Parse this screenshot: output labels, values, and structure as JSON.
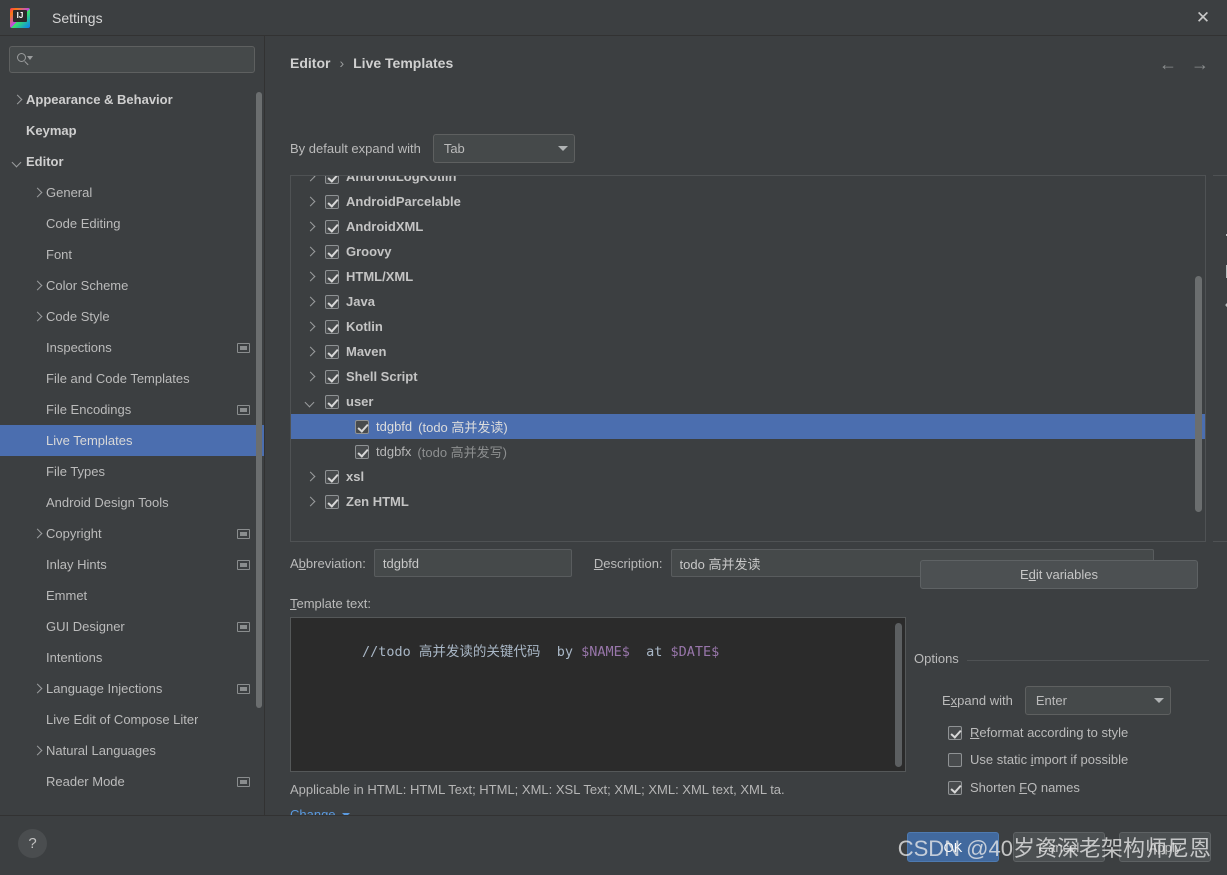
{
  "window": {
    "title": "Settings",
    "logo_icon": "intellij-idea-icon",
    "close_icon": "close-icon"
  },
  "sidebar": {
    "search": {
      "placeholder": "",
      "value": "",
      "icon": "search-icon"
    },
    "items": [
      {
        "label": "Appearance & Behavior",
        "arrow": "right",
        "indent": 0,
        "bold": true,
        "badge": false,
        "selected": false
      },
      {
        "label": "Keymap",
        "arrow": "none",
        "indent": 0,
        "bold": true,
        "badge": false,
        "selected": false
      },
      {
        "label": "Editor",
        "arrow": "down",
        "indent": 0,
        "bold": true,
        "badge": false,
        "selected": false
      },
      {
        "label": "General",
        "arrow": "right",
        "indent": 1,
        "bold": false,
        "badge": false,
        "selected": false
      },
      {
        "label": "Code Editing",
        "arrow": "none",
        "indent": 1,
        "bold": false,
        "badge": false,
        "selected": false
      },
      {
        "label": "Font",
        "arrow": "none",
        "indent": 1,
        "bold": false,
        "badge": false,
        "selected": false
      },
      {
        "label": "Color Scheme",
        "arrow": "right",
        "indent": 1,
        "bold": false,
        "badge": false,
        "selected": false
      },
      {
        "label": "Code Style",
        "arrow": "right",
        "indent": 1,
        "bold": false,
        "badge": false,
        "selected": false
      },
      {
        "label": "Inspections",
        "arrow": "none",
        "indent": 1,
        "bold": false,
        "badge": true,
        "selected": false
      },
      {
        "label": "File and Code Templates",
        "arrow": "none",
        "indent": 1,
        "bold": false,
        "badge": false,
        "selected": false
      },
      {
        "label": "File Encodings",
        "arrow": "none",
        "indent": 1,
        "bold": false,
        "badge": true,
        "selected": false
      },
      {
        "label": "Live Templates",
        "arrow": "none",
        "indent": 1,
        "bold": false,
        "badge": false,
        "selected": true
      },
      {
        "label": "File Types",
        "arrow": "none",
        "indent": 1,
        "bold": false,
        "badge": false,
        "selected": false
      },
      {
        "label": "Android Design Tools",
        "arrow": "none",
        "indent": 1,
        "bold": false,
        "badge": false,
        "selected": false
      },
      {
        "label": "Copyright",
        "arrow": "right",
        "indent": 1,
        "bold": false,
        "badge": true,
        "selected": false
      },
      {
        "label": "Inlay Hints",
        "arrow": "none",
        "indent": 1,
        "bold": false,
        "badge": true,
        "selected": false
      },
      {
        "label": "Emmet",
        "arrow": "none",
        "indent": 1,
        "bold": false,
        "badge": false,
        "selected": false
      },
      {
        "label": "GUI Designer",
        "arrow": "none",
        "indent": 1,
        "bold": false,
        "badge": true,
        "selected": false
      },
      {
        "label": "Intentions",
        "arrow": "none",
        "indent": 1,
        "bold": false,
        "badge": false,
        "selected": false
      },
      {
        "label": "Language Injections",
        "arrow": "right",
        "indent": 1,
        "bold": false,
        "badge": true,
        "selected": false
      },
      {
        "label": "Live Edit of Compose Liter",
        "arrow": "none",
        "indent": 1,
        "bold": false,
        "badge": false,
        "selected": false
      },
      {
        "label": "Natural Languages",
        "arrow": "right",
        "indent": 1,
        "bold": false,
        "badge": false,
        "selected": false
      },
      {
        "label": "Reader Mode",
        "arrow": "none",
        "indent": 1,
        "bold": false,
        "badge": true,
        "selected": false
      }
    ]
  },
  "content": {
    "breadcrumb": {
      "parent": "Editor",
      "separator": "›",
      "current": "Live Templates"
    },
    "nav": {
      "back_icon": "arrow-left-icon",
      "forward_icon": "arrow-right-icon",
      "back": "←",
      "forward": "→"
    },
    "default_expand": {
      "label": "By default expand with",
      "value": "Tab"
    },
    "template_tree": [
      {
        "label": "AndroidLogKotlin",
        "desc": "",
        "arrow": "right",
        "checked": true,
        "indent": 0,
        "selected": false,
        "bold": true
      },
      {
        "label": "AndroidParcelable",
        "desc": "",
        "arrow": "right",
        "checked": true,
        "indent": 0,
        "selected": false,
        "bold": true
      },
      {
        "label": "AndroidXML",
        "desc": "",
        "arrow": "right",
        "checked": true,
        "indent": 0,
        "selected": false,
        "bold": true
      },
      {
        "label": "Groovy",
        "desc": "",
        "arrow": "right",
        "checked": true,
        "indent": 0,
        "selected": false,
        "bold": true
      },
      {
        "label": "HTML/XML",
        "desc": "",
        "arrow": "right",
        "checked": true,
        "indent": 0,
        "selected": false,
        "bold": true
      },
      {
        "label": "Java",
        "desc": "",
        "arrow": "right",
        "checked": true,
        "indent": 0,
        "selected": false,
        "bold": true
      },
      {
        "label": "Kotlin",
        "desc": "",
        "arrow": "right",
        "checked": true,
        "indent": 0,
        "selected": false,
        "bold": true
      },
      {
        "label": "Maven",
        "desc": "",
        "arrow": "right",
        "checked": true,
        "indent": 0,
        "selected": false,
        "bold": true
      },
      {
        "label": "Shell Script",
        "desc": "",
        "arrow": "right",
        "checked": true,
        "indent": 0,
        "selected": false,
        "bold": true
      },
      {
        "label": "user",
        "desc": "",
        "arrow": "down",
        "checked": true,
        "indent": 0,
        "selected": false,
        "bold": true
      },
      {
        "label": "tdgbfd",
        "desc": "(todo 高并发读)",
        "arrow": "none",
        "checked": true,
        "indent": 1,
        "selected": true,
        "bold": false
      },
      {
        "label": "tdgbfx",
        "desc": "(todo 高并发写)",
        "arrow": "none",
        "checked": true,
        "indent": 1,
        "selected": false,
        "bold": false
      },
      {
        "label": "xsl",
        "desc": "",
        "arrow": "right",
        "checked": true,
        "indent": 0,
        "selected": false,
        "bold": true
      },
      {
        "label": "Zen HTML",
        "desc": "",
        "arrow": "right",
        "checked": true,
        "indent": 0,
        "selected": false,
        "bold": true
      }
    ],
    "toolbar": [
      {
        "name": "add-template-button",
        "icon": "plus-icon"
      },
      {
        "name": "remove-template-button",
        "icon": "minus-icon"
      },
      {
        "name": "duplicate-template-button",
        "icon": "copy-icon"
      },
      {
        "name": "reset-template-button",
        "icon": "undo-icon",
        "glyph": "↩"
      }
    ],
    "abbreviation": {
      "label_pre": "A",
      "label_under": "b",
      "label_post": "breviation:",
      "value": "tdgbfd"
    },
    "description": {
      "label_pre": "",
      "label_under": "D",
      "label_post": "escription:",
      "value": "todo 高并发读"
    },
    "template_text": {
      "label_pre": "",
      "label_under": "T",
      "label_post": "emplate text:",
      "comment": "//todo 高并发读的关键代码",
      "mid1": "  by ",
      "var1": "$NAME$",
      "mid2": "  at ",
      "var2": "$DATE$"
    },
    "applicable": "Applicable in HTML: HTML Text; HTML; XML: XSL Text; XML; XML: XML text, XML ta.",
    "change_link": "Change",
    "edit_variables": {
      "label_pre": "E",
      "label_under": "d",
      "label_post": "dit variables"
    },
    "options": {
      "title": "Options",
      "expand_with": {
        "label": "Expand with",
        "value": "Enter"
      },
      "checkboxes": [
        {
          "label": "Reformat according to style",
          "checked": true
        },
        {
          "label": "Use static import if possible",
          "checked": false
        },
        {
          "label": "Shorten FQ names",
          "checked": true
        }
      ]
    }
  },
  "footer": {
    "help_icon": "question-mark-icon",
    "help_glyph": "?",
    "ok": "OK",
    "cancel": "Cancel",
    "apply": "Apply"
  },
  "watermark": "CSDN @40岁资深老架构师尼恩",
  "colors": {
    "background": "#3c3f41",
    "selection": "#4b6eaf",
    "editor_background": "#2b2b2b",
    "accent_link": "#5a9ae0",
    "variable_token": "#9876aa",
    "ok_button": "#41699e"
  }
}
